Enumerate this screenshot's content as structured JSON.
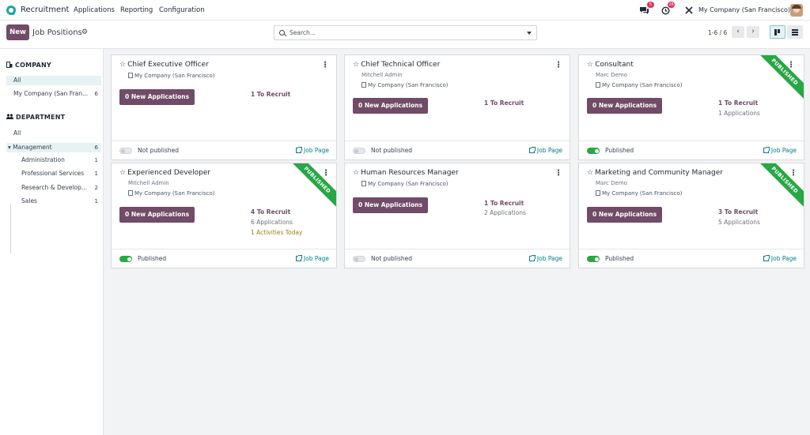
{
  "navbar": {
    "app_name": "Recruitment",
    "menu": [
      "Applications",
      "Reporting",
      "Configuration"
    ],
    "messages_count": "5",
    "activities_count": "26",
    "company": "My Company (San Francisco)"
  },
  "control": {
    "new_label": "New",
    "breadcrumb": "Job Positions",
    "search_placeholder": "Search...",
    "pager": "1-6 / 6"
  },
  "sidebar": {
    "company_heading": "COMPANY",
    "company_items": [
      {
        "label": "All",
        "count": ""
      },
      {
        "label": "My Company (San Fran...",
        "count": "6"
      }
    ],
    "department_heading": "DEPARTMENT",
    "department_items": [
      {
        "label": "All",
        "count": ""
      },
      {
        "label": "Management",
        "count": "6"
      },
      {
        "label": "Administration",
        "count": "1"
      },
      {
        "label": "Professional Services",
        "count": "1"
      },
      {
        "label": "Research & Develop...",
        "count": "2"
      },
      {
        "label": "Sales",
        "count": "1"
      }
    ]
  },
  "cards": [
    {
      "title": "Chief Executive Officer",
      "user": "",
      "company": "My Company (San Francisco)",
      "new_apps": "0 New Applications",
      "to_recruit": "1 To Recruit",
      "applications": "",
      "activities": "",
      "published": false,
      "status_label": "Not published",
      "job_page": "Job Page",
      "ribbon": ""
    },
    {
      "title": "Chief Technical Officer",
      "user": "Mitchell Admin",
      "company": "My Company (San Francisco)",
      "new_apps": "0 New Applications",
      "to_recruit": "1 To Recruit",
      "applications": "",
      "activities": "",
      "published": false,
      "status_label": "Not published",
      "job_page": "Job Page",
      "ribbon": ""
    },
    {
      "title": "Consultant",
      "user": "Marc Demo",
      "company": "My Company (San Francisco)",
      "new_apps": "0 New Applications",
      "to_recruit": "1 To Recruit",
      "applications": "1 Applications",
      "activities": "",
      "published": true,
      "status_label": "Published",
      "job_page": "Job Page",
      "ribbon": "PUBLISHED"
    },
    {
      "title": "Experienced Developer",
      "user": "Mitchell Admin",
      "company": "My Company (San Francisco)",
      "new_apps": "0 New Applications",
      "to_recruit": "4 To Recruit",
      "applications": "6 Applications",
      "activities": "1 Activities Today",
      "published": true,
      "status_label": "Published",
      "job_page": "Job Page",
      "ribbon": "PUBLISHED"
    },
    {
      "title": "Human Resources Manager",
      "user": "",
      "company": "My Company (San Francisco)",
      "new_apps": "0 New Applications",
      "to_recruit": "1 To Recruit",
      "applications": "2 Applications",
      "activities": "",
      "published": false,
      "status_label": "Not published",
      "job_page": "Job Page",
      "ribbon": ""
    },
    {
      "title": "Marketing and Community Manager",
      "user": "Marc Demo",
      "company": "My Company (San Francisco)",
      "new_apps": "0 New Applications",
      "to_recruit": "3 To Recruit",
      "applications": "5 Applications",
      "activities": "",
      "published": true,
      "status_label": "Published",
      "job_page": "Job Page",
      "ribbon": "PUBLISHED"
    }
  ]
}
